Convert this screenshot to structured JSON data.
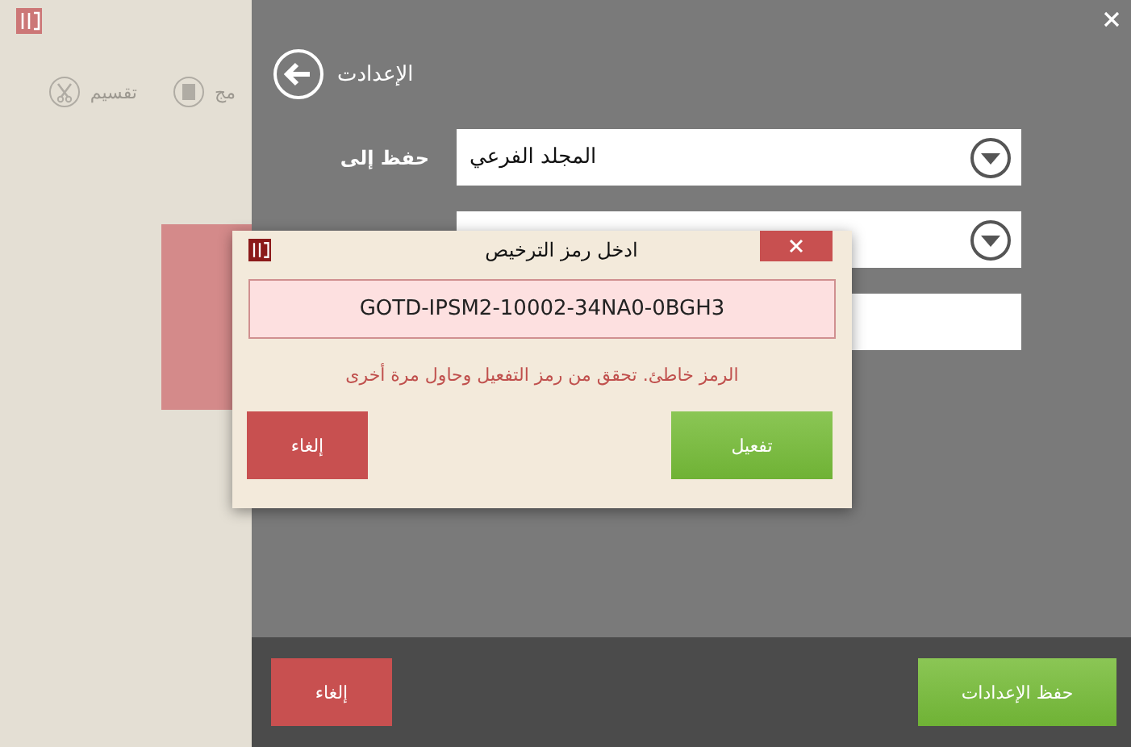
{
  "tools": [
    {
      "kind": "merge",
      "label": "مج"
    },
    {
      "kind": "split",
      "label": "تقسيم"
    }
  ],
  "settings": {
    "title": "الإعدادت",
    "rows": [
      {
        "kind": "select",
        "label": "حفظ إلى",
        "value": "المجلد الفرعي"
      },
      {
        "kind": "select"
      },
      {
        "kind": "text"
      }
    ],
    "buttons": [
      {
        "kind": "save",
        "label": "حفظ الإعدادات"
      },
      {
        "kind": "cancel",
        "label": "إلغاء"
      }
    ]
  },
  "dialog": {
    "title": "ادخل رمز الترخيص",
    "value": "GOTD-IPSM2-10002-34NA0-0BGH3",
    "invalid": true,
    "error": "الرمز خاطئ. تحقق من رمز التفعيل وحاول مرة أخرى",
    "buttons": [
      {
        "kind": "activate",
        "label": "تفعيل"
      },
      {
        "kind": "cancel",
        "label": "إلغاء"
      }
    ]
  }
}
